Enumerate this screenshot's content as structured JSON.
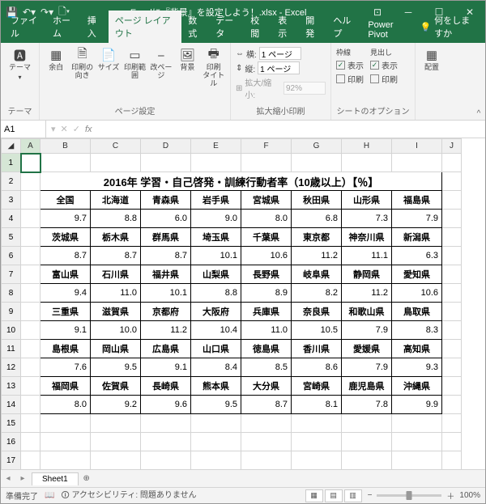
{
  "title": "Excelに『背景』を設定しよう！.xlsx - Excel",
  "tabs": [
    "ファイル",
    "ホーム",
    "挿入",
    "ページ レイアウト",
    "数式",
    "データ",
    "校閲",
    "表示",
    "開発",
    "ヘルプ",
    "Power Pivot"
  ],
  "active_tab": 3,
  "tellme": "何をしますか",
  "ribbon": {
    "themes": {
      "label": "テーマ",
      "btn": "テーマ"
    },
    "page_setup": {
      "label": "ページ設定",
      "margins": "余白",
      "orient": "印刷の\n向き",
      "size": "サイズ",
      "area": "印刷範囲",
      "breaks": "改ページ",
      "bg": "背景",
      "titles": "印刷\nタイトル"
    },
    "scale": {
      "label": "拡大縮小印刷",
      "width": "横:",
      "height": "縦:",
      "wval": "1 ページ",
      "hval": "1 ページ",
      "ratio": "拡大/縮小:",
      "rval": "92%"
    },
    "sheet_opts": {
      "label": "シートのオプション",
      "gridlines": "枠線",
      "headings": "見出し",
      "view": "表示",
      "print": "印刷"
    },
    "arrange": {
      "label": "",
      "btn": "配置"
    }
  },
  "namebox": "A1",
  "fx": "fx",
  "cols": [
    "A",
    "B",
    "C",
    "D",
    "E",
    "F",
    "G",
    "H",
    "I",
    "J"
  ],
  "rows_shown": 17,
  "chart_data": {
    "type": "table",
    "title": "2016年 学習・自己啓発・訓練行動者率（10歳以上）【％】",
    "blocks": [
      {
        "headers": [
          "全国",
          "北海道",
          "青森県",
          "岩手県",
          "宮城県",
          "秋田県",
          "山形県",
          "福島県"
        ],
        "values": [
          9.7,
          8.8,
          6.0,
          9.0,
          8.0,
          6.8,
          7.3,
          7.9
        ]
      },
      {
        "headers": [
          "茨城県",
          "栃木県",
          "群馬県",
          "埼玉県",
          "千葉県",
          "東京都",
          "神奈川県",
          "新潟県"
        ],
        "values": [
          8.7,
          8.7,
          8.7,
          10.1,
          10.6,
          11.2,
          11.1,
          6.3
        ]
      },
      {
        "headers": [
          "富山県",
          "石川県",
          "福井県",
          "山梨県",
          "長野県",
          "岐阜県",
          "静岡県",
          "愛知県"
        ],
        "values": [
          9.4,
          11.0,
          10.1,
          8.8,
          8.9,
          8.2,
          11.2,
          10.6
        ]
      },
      {
        "headers": [
          "三重県",
          "滋賀県",
          "京都府",
          "大阪府",
          "兵庫県",
          "奈良県",
          "和歌山県",
          "鳥取県"
        ],
        "values": [
          9.1,
          10.0,
          11.2,
          10.4,
          11.0,
          10.5,
          7.9,
          8.3
        ]
      },
      {
        "headers": [
          "島根県",
          "岡山県",
          "広島県",
          "山口県",
          "徳島県",
          "香川県",
          "愛媛県",
          "高知県"
        ],
        "values": [
          7.6,
          9.5,
          9.1,
          8.4,
          8.5,
          8.6,
          7.9,
          9.3
        ]
      },
      {
        "headers": [
          "福岡県",
          "佐賀県",
          "長崎県",
          "熊本県",
          "大分県",
          "宮崎県",
          "鹿児島県",
          "沖縄県"
        ],
        "values": [
          8.0,
          9.2,
          9.6,
          9.5,
          8.7,
          8.1,
          7.8,
          9.9
        ]
      }
    ]
  },
  "sheet": "Sheet1",
  "status": {
    "ready": "準備完了",
    "acc": "アクセシビリティ: 問題ありません",
    "zoom": "100%"
  }
}
